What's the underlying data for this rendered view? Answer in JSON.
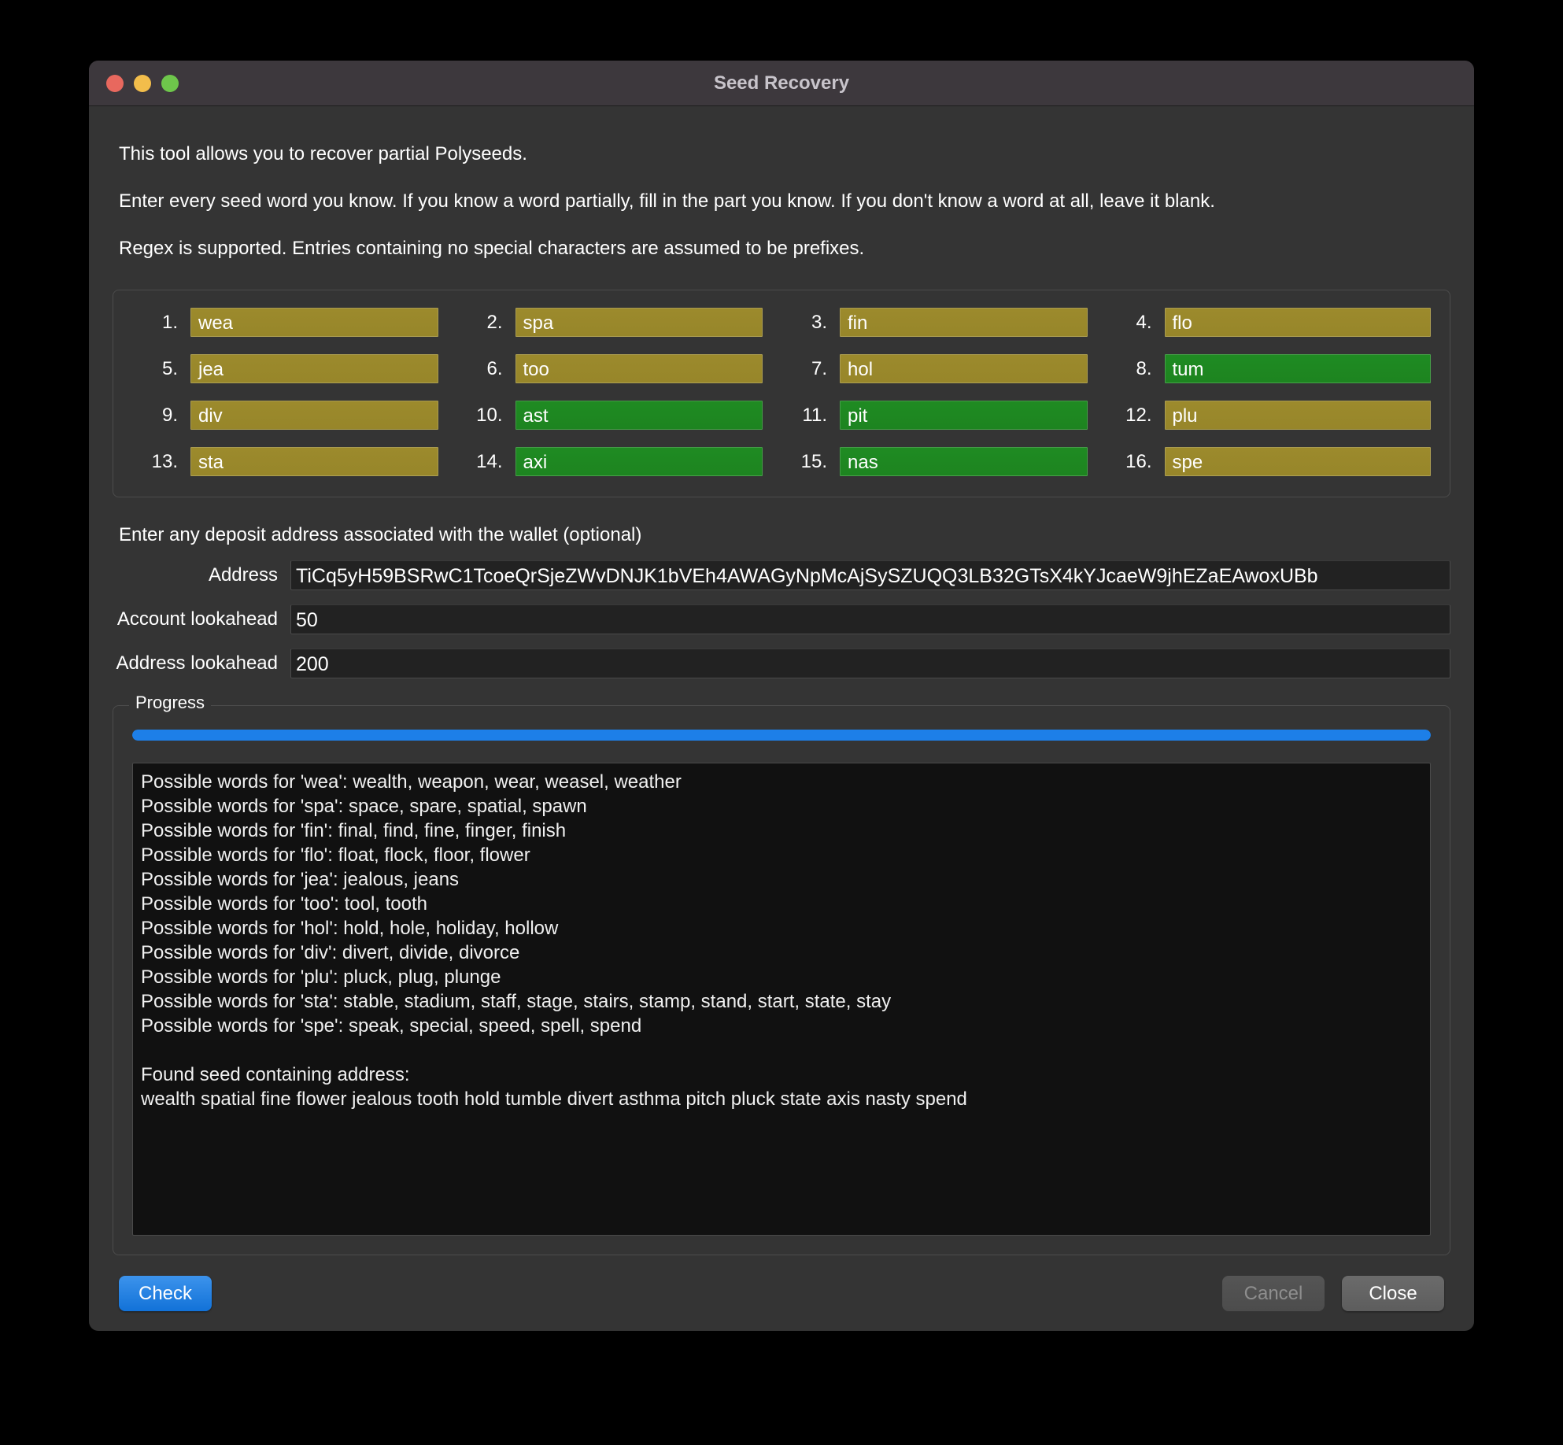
{
  "window": {
    "title": "Seed Recovery",
    "traffic_lights": [
      "close-red",
      "minimize-yellow",
      "zoom-green"
    ]
  },
  "intro": {
    "line1": "This tool allows you to recover partial Polyseeds.",
    "line2": "Enter every seed word you know. If you know a word partially, fill in the part you know. If you don't know a word at all, leave it blank.",
    "line3": "Regex is supported. Entries containing no special characters are assumed to be prefixes."
  },
  "seed_grid": {
    "entries": [
      {
        "num": "1.",
        "value": "wea",
        "state": "partial"
      },
      {
        "num": "2.",
        "value": "spa",
        "state": "partial"
      },
      {
        "num": "3.",
        "value": "fin",
        "state": "partial"
      },
      {
        "num": "4.",
        "value": "flo",
        "state": "partial"
      },
      {
        "num": "5.",
        "value": "jea",
        "state": "partial"
      },
      {
        "num": "6.",
        "value": "too",
        "state": "partial"
      },
      {
        "num": "7.",
        "value": "hol",
        "state": "partial"
      },
      {
        "num": "8.",
        "value": "tum",
        "state": "resolved"
      },
      {
        "num": "9.",
        "value": "div",
        "state": "partial"
      },
      {
        "num": "10.",
        "value": "ast",
        "state": "resolved"
      },
      {
        "num": "11.",
        "value": "pit",
        "state": "resolved"
      },
      {
        "num": "12.",
        "value": "plu",
        "state": "partial"
      },
      {
        "num": "13.",
        "value": "sta",
        "state": "partial"
      },
      {
        "num": "14.",
        "value": "axi",
        "state": "resolved"
      },
      {
        "num": "15.",
        "value": "nas",
        "state": "resolved"
      },
      {
        "num": "16.",
        "value": "spe",
        "state": "partial"
      }
    ],
    "colors": {
      "partial": "#9c8a2c",
      "resolved": "#1f8b22"
    }
  },
  "address_section": {
    "hint": "Enter any deposit address associated with the wallet (optional)",
    "address_label": "Address",
    "address_value": "TiCq5yH59BSRwC1TcoeQrSjeZWvDNJK1bVEh4AWAGyNpMcAjSySZUQQ3LB32GTsX4kYJcaeW9jhEZaEAwoxUBb",
    "account_lookahead_label": "Account lookahead",
    "account_lookahead_value": "50",
    "address_lookahead_label": "Address lookahead",
    "address_lookahead_value": "200"
  },
  "progress": {
    "legend": "Progress",
    "percent": 100,
    "bar_color": "#1d7fe8",
    "log_lines": [
      "Possible words for 'wea': wealth, weapon, wear, weasel, weather",
      "Possible words for 'spa': space, spare, spatial, spawn",
      "Possible words for 'fin': final, find, fine, finger, finish",
      "Possible words for 'flo': float, flock, floor, flower",
      "Possible words for 'jea': jealous, jeans",
      "Possible words for 'too': tool, tooth",
      "Possible words for 'hol': hold, hole, holiday, hollow",
      "Possible words for 'div': divert, divide, divorce",
      "Possible words for 'plu': pluck, plug, plunge",
      "Possible words for 'sta': stable, stadium, staff, stage, stairs, stamp, stand, start, state, stay",
      "Possible words for 'spe': speak, special, speed, spell, spend",
      "",
      "Found seed containing address:",
      "wealth spatial fine flower jealous tooth hold tumble divert asthma pitch pluck state axis nasty spend"
    ]
  },
  "footer": {
    "check_label": "Check",
    "cancel_label": "Cancel",
    "close_label": "Close",
    "cancel_disabled": true
  }
}
